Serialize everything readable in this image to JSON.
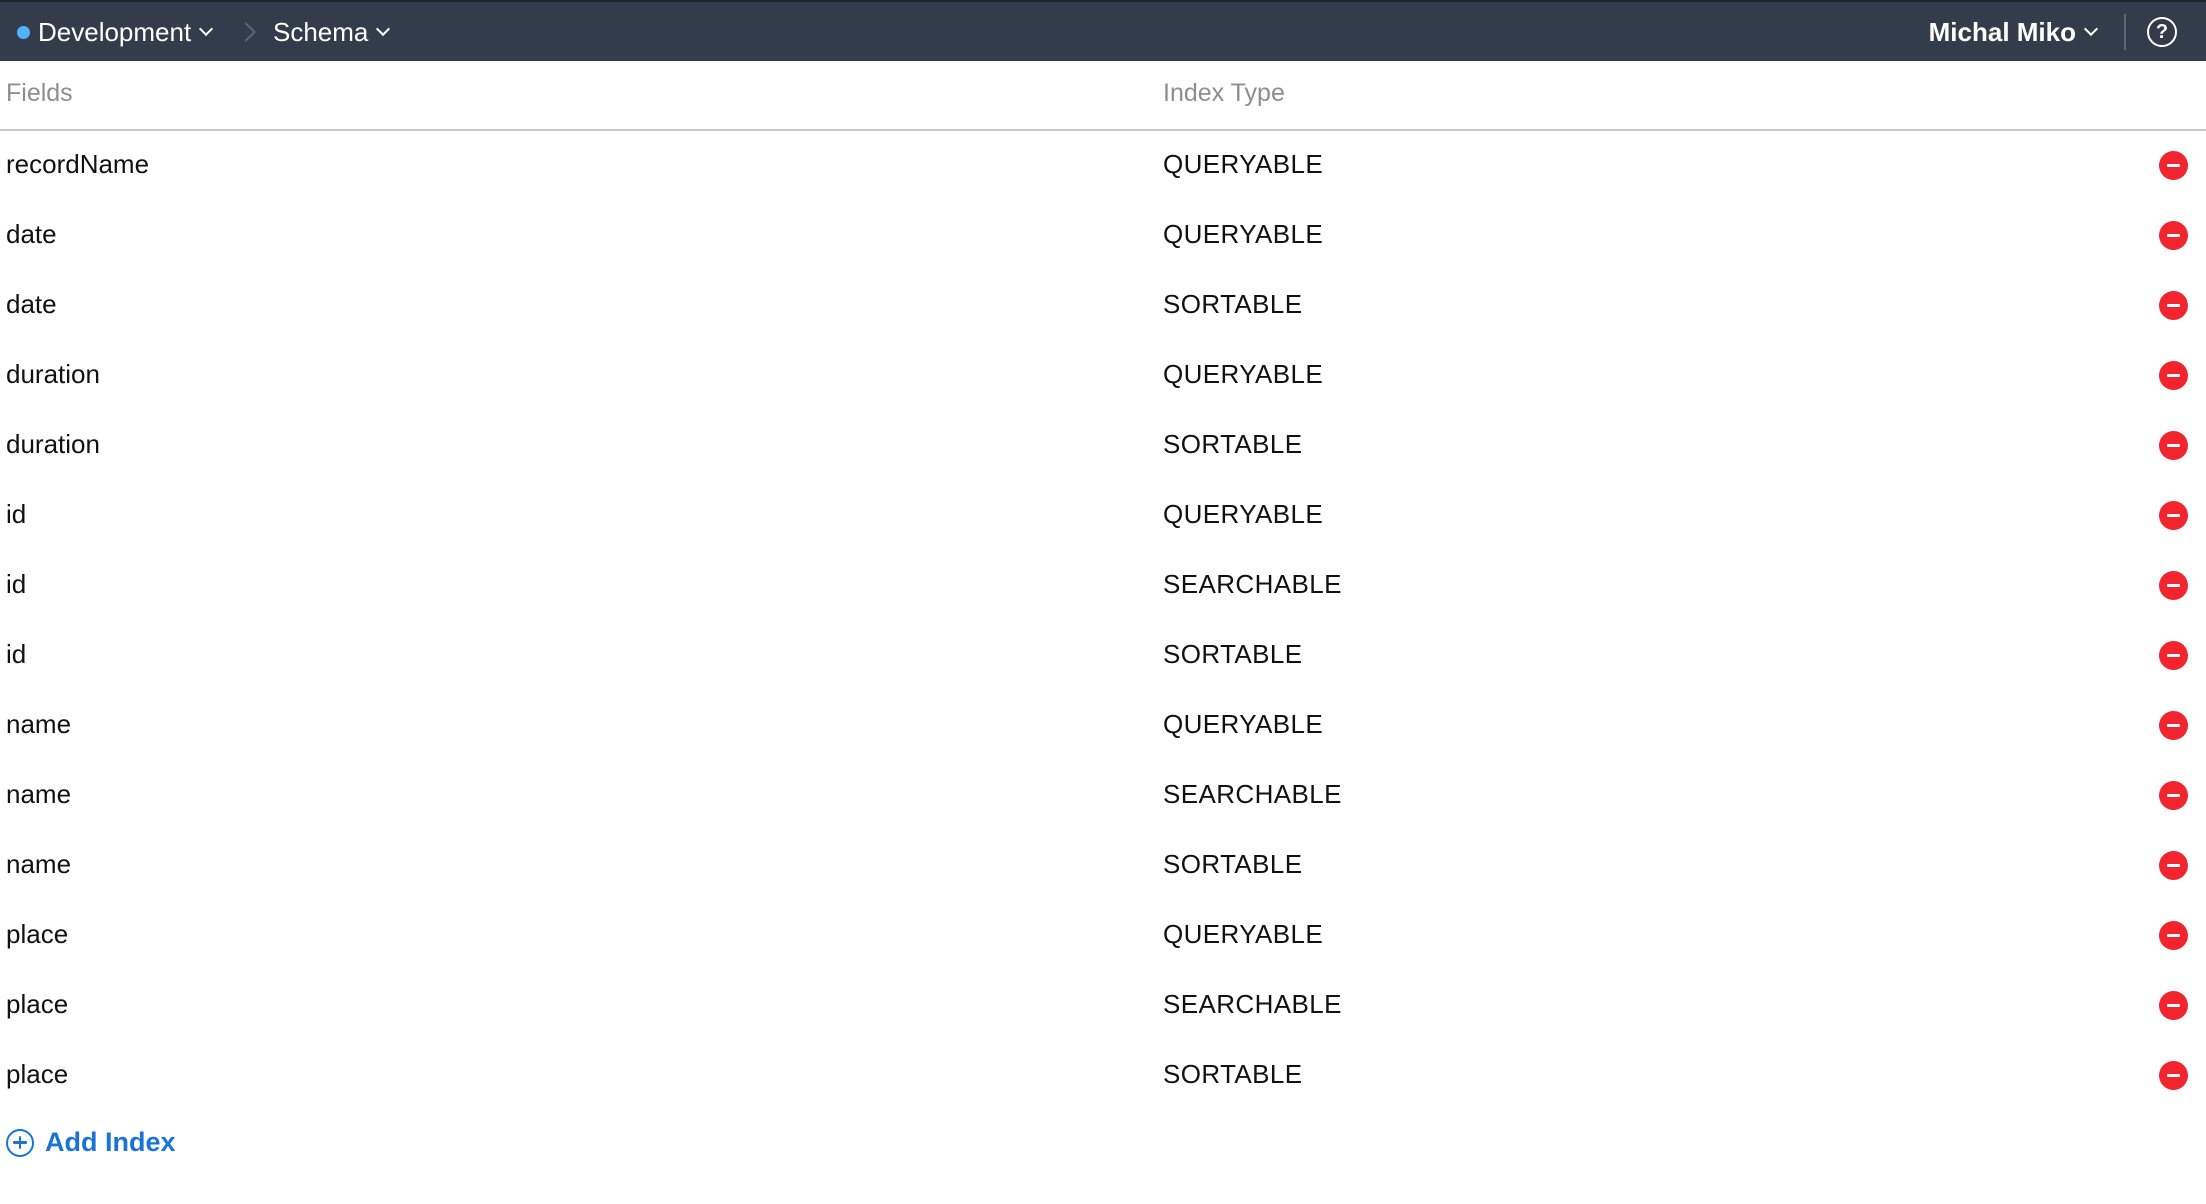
{
  "topbar": {
    "environment": "Development",
    "section": "Schema",
    "user": "Michal Miko",
    "help_symbol": "?",
    "environment_dot_color": "#4fb3ff",
    "background_color": "#333c4a"
  },
  "table": {
    "headers": {
      "fields": "Fields",
      "index_type": "Index Type"
    },
    "rows": [
      {
        "field": "recordName",
        "index_type": "QUERYABLE"
      },
      {
        "field": "date",
        "index_type": "QUERYABLE"
      },
      {
        "field": "date",
        "index_type": "SORTABLE"
      },
      {
        "field": "duration",
        "index_type": "QUERYABLE"
      },
      {
        "field": "duration",
        "index_type": "SORTABLE"
      },
      {
        "field": "id",
        "index_type": "QUERYABLE"
      },
      {
        "field": "id",
        "index_type": "SEARCHABLE"
      },
      {
        "field": "id",
        "index_type": "SORTABLE"
      },
      {
        "field": "name",
        "index_type": "QUERYABLE"
      },
      {
        "field": "name",
        "index_type": "SEARCHABLE"
      },
      {
        "field": "name",
        "index_type": "SORTABLE"
      },
      {
        "field": "place",
        "index_type": "QUERYABLE"
      },
      {
        "field": "place",
        "index_type": "SEARCHABLE"
      },
      {
        "field": "place",
        "index_type": "SORTABLE"
      }
    ],
    "remove_icon": "remove-circle-icon",
    "remove_color": "#f2252f"
  },
  "actions": {
    "add_index_label": "Add Index",
    "add_index_icon": "plus-circle-icon",
    "accent_color": "#1a74d8"
  }
}
